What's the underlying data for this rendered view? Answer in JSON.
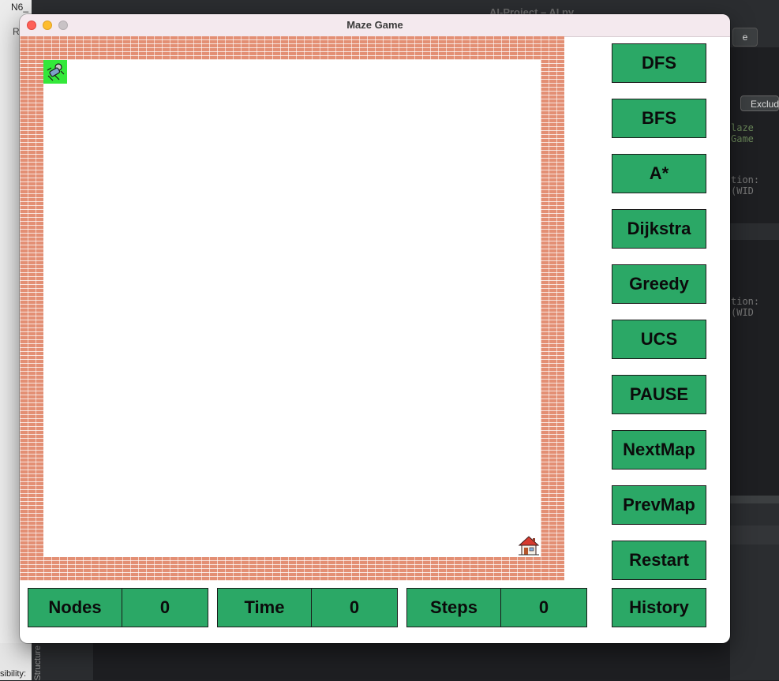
{
  "background": {
    "left_title": "N6_",
    "left_r": "R",
    "top_title": "AI-Project – AI.py",
    "structure_label": "Structure",
    "visibility_label": "sibility:",
    "right_pill": "e",
    "right_exclude": "Exclud",
    "code_lines": [
      "laze Game",
      "tion: (WID",
      "tion: (WID"
    ]
  },
  "window": {
    "title": "Maze Game"
  },
  "sidebar": {
    "buttons": [
      {
        "label": "DFS"
      },
      {
        "label": "BFS"
      },
      {
        "label": "A*"
      },
      {
        "label": "Dijkstra"
      },
      {
        "label": "Greedy"
      },
      {
        "label": "UCS"
      },
      {
        "label": "PAUSE"
      },
      {
        "label": "NextMap"
      },
      {
        "label": "PrevMap"
      },
      {
        "label": "Restart"
      },
      {
        "label": "History"
      }
    ]
  },
  "stats": {
    "nodes_label": "Nodes",
    "nodes_value": "0",
    "time_label": "Time",
    "time_value": "0",
    "steps_label": "Steps",
    "steps_value": "0"
  },
  "colors": {
    "button_green": "#2ba866",
    "player_green": "#34e83a",
    "wall_brick": "#e38f74"
  },
  "icons": {
    "player": "player-sprite-icon",
    "goal": "house-icon"
  }
}
